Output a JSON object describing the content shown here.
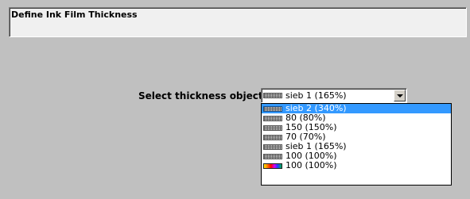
{
  "header": {
    "title": "Define Ink Film Thickness"
  },
  "form": {
    "label": "Select thickness object:",
    "selected_value": "sieb 1  (165%)",
    "selected_swatch_icon": "screen-mesh-icon"
  },
  "dropdown": {
    "highlight_color": "#3399ff",
    "options": [
      {
        "label": "sieb 2  (340%)",
        "icon": "screen-mesh-icon",
        "highlighted": true
      },
      {
        "label": "80  (80%)",
        "icon": "screen-mesh-icon",
        "highlighted": false
      },
      {
        "label": "150  (150%)",
        "icon": "screen-mesh-icon",
        "highlighted": false
      },
      {
        "label": "70  (70%)",
        "icon": "screen-mesh-icon",
        "highlighted": false
      },
      {
        "label": "sieb 1  (165%)",
        "icon": "screen-mesh-icon",
        "highlighted": false
      },
      {
        "label": "100  (100%)",
        "icon": "screen-mesh-icon",
        "highlighted": false
      },
      {
        "label": "100  (100%)",
        "icon": "rainbow-color-icon",
        "highlighted": false
      }
    ]
  }
}
